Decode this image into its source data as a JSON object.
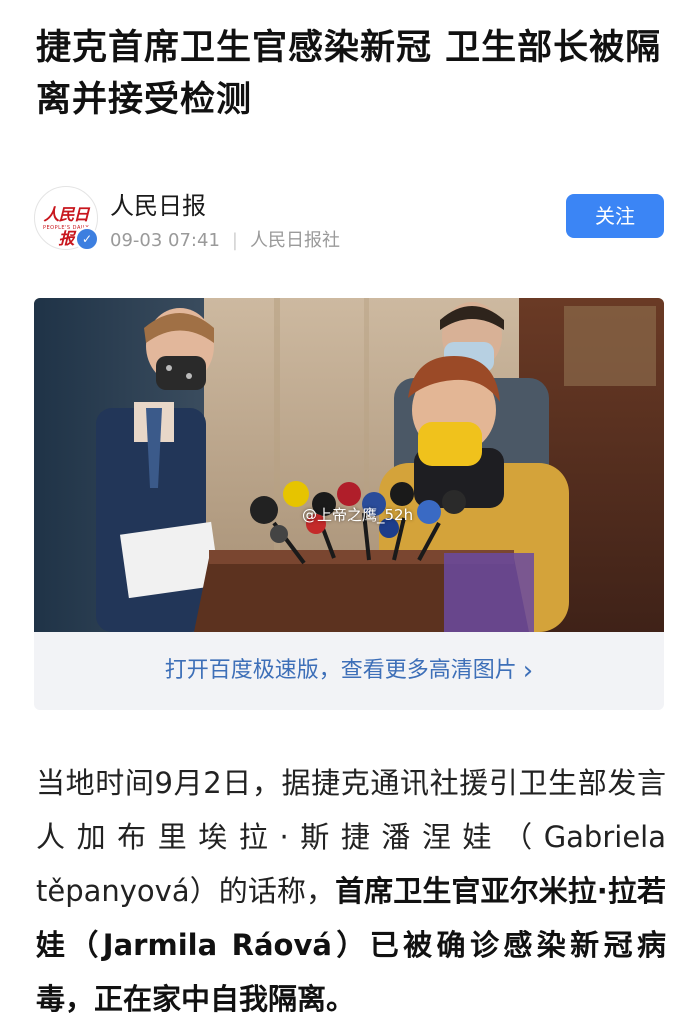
{
  "article": {
    "title": "捷克首席卫生官感染新冠 卫生部长被隔离并接受检测"
  },
  "author": {
    "name": "人民日报",
    "avatar_logo_text": "人民日报",
    "avatar_sub_text": "PEOPLE'S DAILY",
    "date": "09-03 07:41",
    "source": "人民日报社",
    "verified_icon": "verified-check-icon",
    "follow_label": "关注"
  },
  "image": {
    "watermark": "@上帝之鹰_52h"
  },
  "open_app": {
    "label": "打开百度极速版，查看更多高清图片",
    "chevron": "›"
  },
  "body": {
    "part1": "当地时间9月2日，据捷克通讯社援引卫生部发言人加布里埃拉·斯捷潘涅娃（Gabriela těpanyová）的话称，",
    "part2_bold": "首席卫生官亚尔米拉·拉若娃（Jarmila Ráová）已被确诊感染新冠病毒，正在家中自我隔离。"
  },
  "colors": {
    "accent": "#3b85f5",
    "link": "#3d6fb8",
    "brand_red": "#c8161d",
    "meta_gray": "#9a9a9a"
  }
}
